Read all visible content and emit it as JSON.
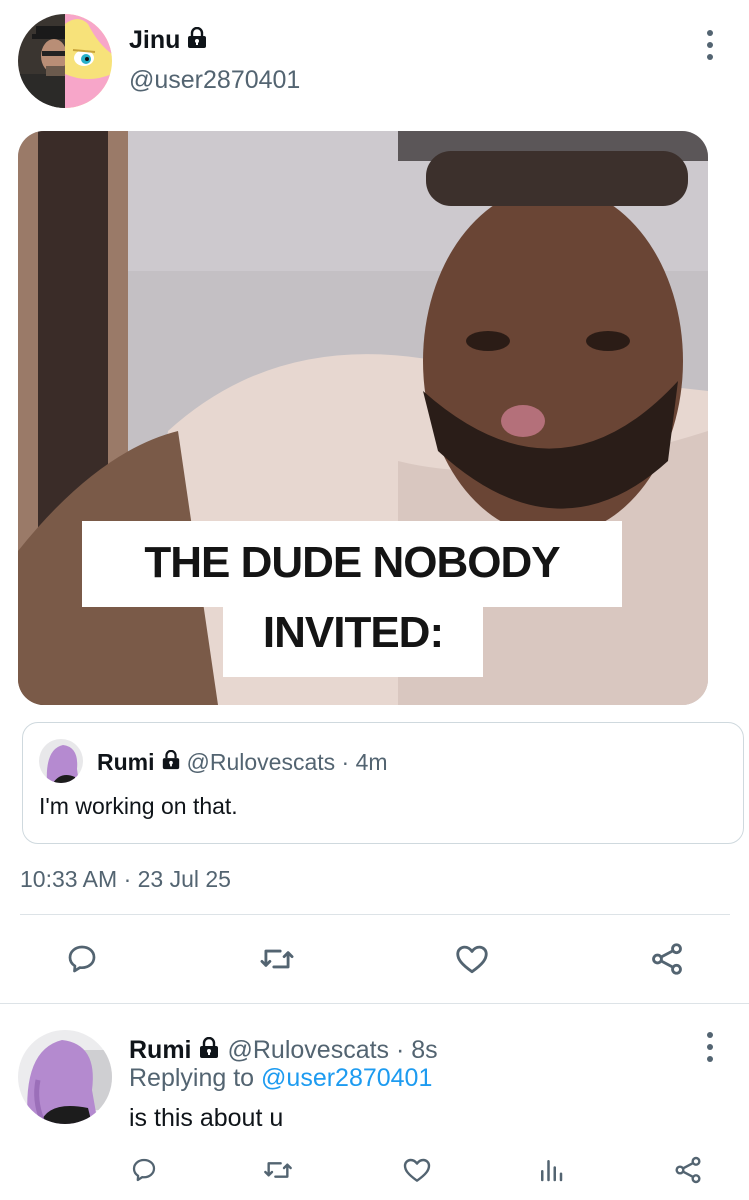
{
  "tweet": {
    "author": {
      "name": "Jinu",
      "handle": "@user2870401"
    },
    "media": {
      "caption_line1": "THE DUDE NOBODY",
      "caption_line2": "INVITED:"
    },
    "quote": {
      "name": "Rumi",
      "handle": "@Rulovescats · 4m",
      "text": "I'm working on that."
    },
    "timestamp": "10:33 AM · 23 Jul 25",
    "actions": [
      "reply-icon",
      "retweet-icon",
      "like-icon",
      "share-icon"
    ]
  },
  "reply": {
    "author": {
      "name": "Rumi",
      "handle": "@Rulovescats · 8s"
    },
    "replying_prefix": "Replying to",
    "replying_mention": "@user2870401",
    "text": "is this about u",
    "actions": [
      "reply-icon",
      "retweet-icon",
      "like-icon",
      "analytics-icon",
      "share-icon"
    ]
  },
  "colors": {
    "accent": "#1d9bf0",
    "secondary_text": "#536471",
    "primary_text": "#0f1419",
    "divider": "#dde3e7"
  }
}
